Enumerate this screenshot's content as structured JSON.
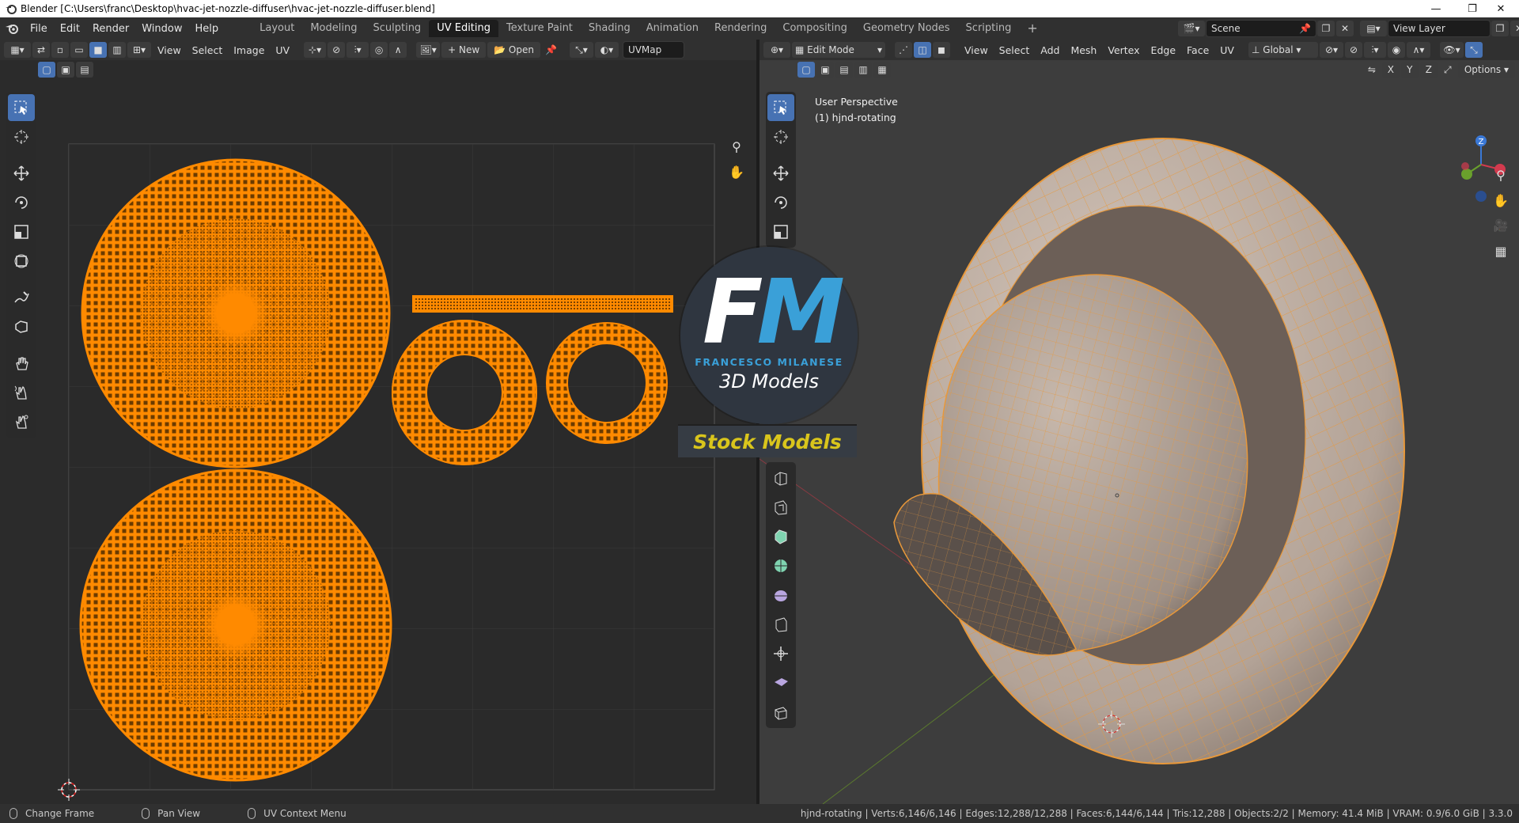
{
  "window": {
    "title": "Blender [C:\\Users\\franc\\Desktop\\hvac-jet-nozzle-diffuser\\hvac-jet-nozzle-diffuser.blend]",
    "controls": [
      "—",
      "❐",
      "✕"
    ]
  },
  "menu": [
    "File",
    "Edit",
    "Render",
    "Window",
    "Help"
  ],
  "workspaces": [
    "Layout",
    "Modeling",
    "Sculpting",
    "UV Editing",
    "Texture Paint",
    "Shading",
    "Animation",
    "Rendering",
    "Compositing",
    "Geometry Nodes",
    "Scripting"
  ],
  "active_workspace": "UV Editing",
  "scene": "Scene",
  "view_layer": "View Layer",
  "uv_editor": {
    "menus": [
      "View",
      "Select",
      "Image",
      "UV"
    ],
    "new_label": "New",
    "open_label": "Open",
    "uvmap": "UVMap"
  },
  "viewport": {
    "mode": "Edit Mode",
    "menus": [
      "View",
      "Select",
      "Add",
      "Mesh",
      "Vertex",
      "Edge",
      "Face",
      "UV"
    ],
    "orientation": "Global",
    "options_label": "Options",
    "axis_labels": [
      "X",
      "Y",
      "Z"
    ],
    "info_line1": "User Perspective",
    "info_line2": "(1) hjnd-rotating",
    "gizmo": {
      "z": "Z",
      "y": "Y"
    }
  },
  "status": {
    "left": [
      {
        "label": "Change Frame"
      },
      {
        "label": "Pan View"
      },
      {
        "label": "UV Context Menu"
      }
    ],
    "right": "hjnd-rotating | Verts:6,146/6,146 | Edges:12,288/12,288 | Faces:6,144/6,144 | Tris:12,288 | Objects:2/2 | Memory: 41.4 MiB | VRAM: 0.9/6.0 GiB | 3.3.0"
  },
  "watermark": {
    "initial_f": "F",
    "initial_m": "M",
    "name": "FRANCESCO MILANESE",
    "subtitle": "3D Models",
    "banner": "Stock Models"
  },
  "colors": {
    "accent": "#4772b3",
    "uv_orange": "#ff8a00",
    "mesh_wire": "#e8983a"
  }
}
